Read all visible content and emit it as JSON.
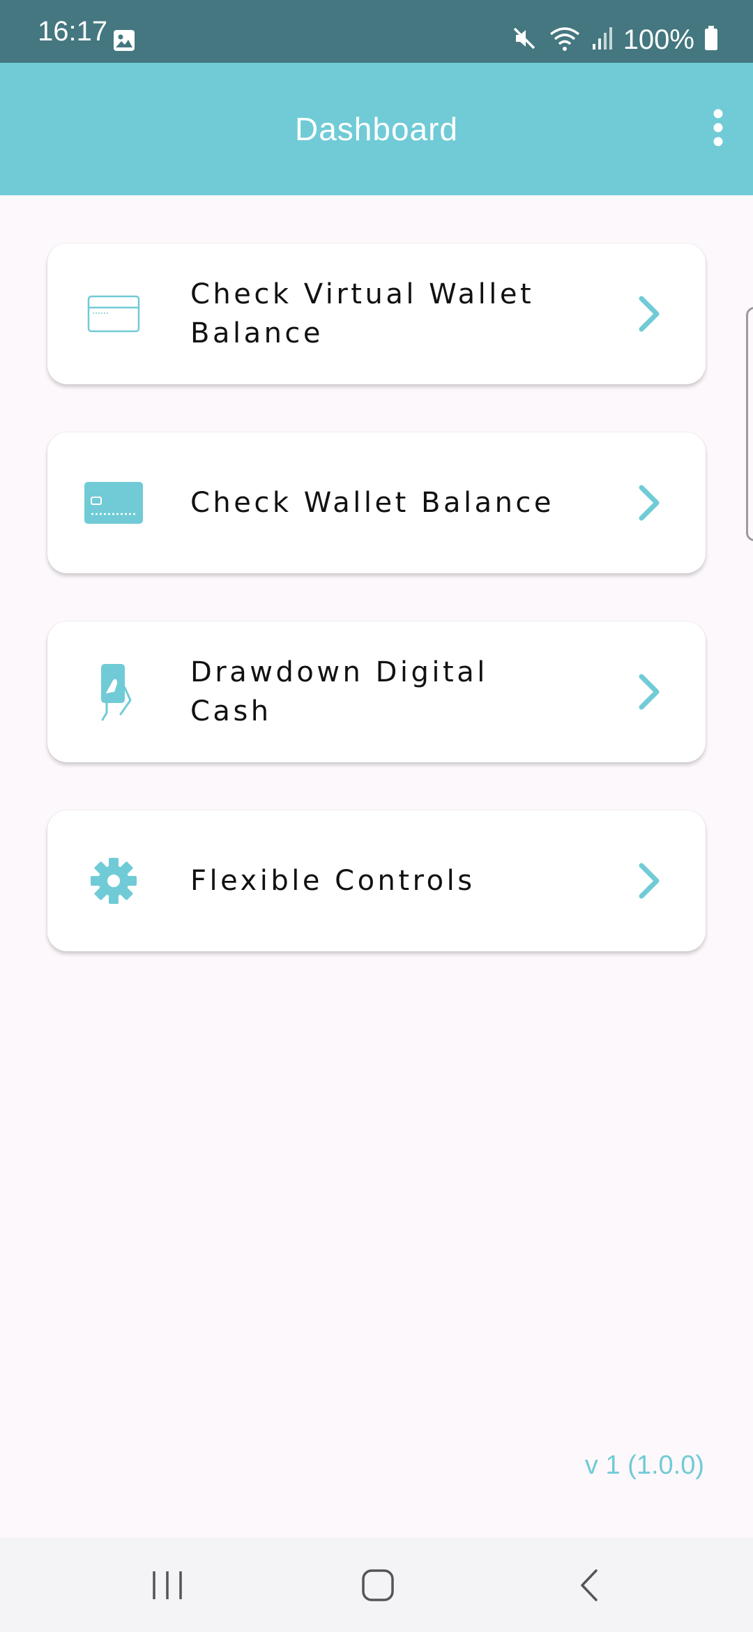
{
  "status_bar": {
    "time": "16:17",
    "battery_text": "100%",
    "icons": [
      "gallery-icon",
      "mute-icon",
      "wifi-icon",
      "signal-icon",
      "battery-icon"
    ]
  },
  "app_bar": {
    "title": "Dashboard",
    "menu_icon": "more-vert-icon"
  },
  "menu_items": [
    {
      "label": "Check Virtual Wallet Balance",
      "icon": "card-outline-icon"
    },
    {
      "label": "Check Wallet Balance",
      "icon": "card-filled-icon"
    },
    {
      "label": "Drawdown Digital Cash",
      "icon": "hand-phone-icon"
    },
    {
      "label": "Flexible Controls",
      "icon": "gear-icon"
    }
  ],
  "footer": {
    "version": "v 1 (1.0.0)"
  },
  "nav_bar": {
    "buttons": [
      "recents-button",
      "home-button",
      "back-button"
    ]
  },
  "colors": {
    "status_bar": "#44777f",
    "accent": "#70cbd6",
    "background": "#fdf8fc",
    "text": "#111111"
  }
}
